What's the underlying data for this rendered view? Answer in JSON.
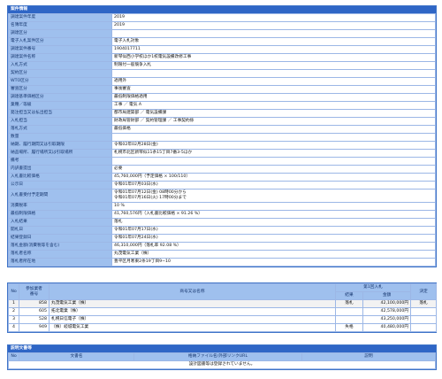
{
  "info": {
    "title": "案件情報",
    "rows": [
      {
        "label": "調達案件年度",
        "value": "2019"
      },
      {
        "label": "名簿年度",
        "value": "2019"
      },
      {
        "label": "調達区分",
        "value": ""
      },
      {
        "label": "電子入札案件区分",
        "value": "電子入札対象"
      },
      {
        "label": "調達案件番号",
        "value": "1904017711"
      },
      {
        "label": "調達案件名称",
        "value": "新琴似西小学校ほか1校電気設備改修工事"
      },
      {
        "label": "入札方式",
        "value": "制限付一般競争入札"
      },
      {
        "label": "契約区分",
        "value": ""
      },
      {
        "label": "WTO区分",
        "value": "適用外"
      },
      {
        "label": "審査区分",
        "value": "事後審査"
      },
      {
        "label": "調達基準価格区分",
        "value": "最低制限価格適用"
      },
      {
        "label": "業種／等級",
        "value": "工事 ／ 電気 A"
      },
      {
        "label": "発注担当又は払出担当",
        "value": "都市局建築部 ／ 電気設備課"
      },
      {
        "label": "入札担当",
        "value": "財政局管財部 ／ 契約管理課 ／ 工事契約係"
      },
      {
        "label": "落札方式",
        "value": "最低価格"
      },
      {
        "label": "数量",
        "value": ""
      },
      {
        "label": "納期、履行期間又は引取期限",
        "value": "令和02年02月28日(金)"
      },
      {
        "label": "納品場所、履行場所又は引取場所",
        "value": "札幌市北区新琴似11条15丁目7番3-5ほか"
      },
      {
        "label": "備考",
        "value": ""
      },
      {
        "label": "内訳書提出",
        "value": "必要"
      },
      {
        "label": "入札書比較価格",
        "value": "45,760,000円（予定価格 × 100/110）"
      },
      {
        "label": "公示日",
        "value": "令和01年07月03日(水)"
      },
      {
        "label": "入札書受付予定期間",
        "value": "令和01年07月12日(金) 08時00分から\n令和01年07月16日(火) 17時00分まで",
        "two": true
      },
      {
        "label": "消費税率",
        "value": "10 %"
      },
      {
        "label": "最低制限価格",
        "value": "41,760,576円（入札書比較価格 × 91.26 %）"
      },
      {
        "label": "入札結果",
        "value": "落札"
      },
      {
        "label": "開札日",
        "value": "令和01年07月17日(水)"
      },
      {
        "label": "結果登録日",
        "value": "令和01年07月24日(水)"
      },
      {
        "label": "落札金額(消費税等を含む)",
        "value": "46,310,000円（落札率 92.08 %）"
      },
      {
        "label": "落札者名称",
        "value": "丸茂電気工業（株）"
      },
      {
        "label": "落札者所在地",
        "value": "豊平区月寒東2条19丁目9−10"
      }
    ]
  },
  "bidders": {
    "headers": {
      "no": "No",
      "code": "参加業者\n番号",
      "name": "商号又は名称",
      "round1": "第1回入札",
      "result": "結果",
      "amount": "金額",
      "decision": "決定"
    },
    "rows": [
      {
        "no": "1",
        "code": "858",
        "name": "丸茂電気工業（株）",
        "result": "落札",
        "amount": "42,100,000円",
        "decision": "落札"
      },
      {
        "no": "2",
        "code": "605",
        "name": "拓北電業（株）",
        "result": "",
        "amount": "42,578,000円",
        "decision": ""
      },
      {
        "no": "3",
        "code": "528",
        "name": "札幌日信電子（株）",
        "result": "",
        "amount": "43,250,000円",
        "decision": ""
      },
      {
        "no": "4",
        "code": "949",
        "name": "（株）岐城電気工業",
        "result": "失格",
        "amount": "40,480,000円",
        "decision": ""
      }
    ]
  },
  "docs": {
    "title": "説明文書等",
    "headers": {
      "no": "No",
      "name": "文書名",
      "file": "格納ファイル名/外部リンクURL",
      "note": "説明"
    },
    "empty_message": "設計図書等は登録されていません。"
  }
}
